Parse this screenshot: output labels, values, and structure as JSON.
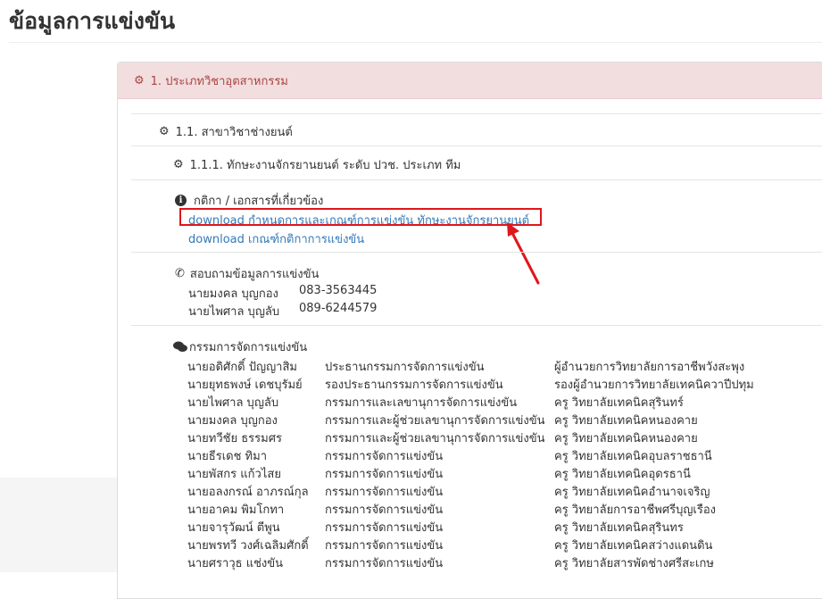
{
  "page": {
    "title": "ข้อมูลการแข่งขัน"
  },
  "category": {
    "heading": "1. ประเภทวิชาอุตสาหกรรม"
  },
  "branch": {
    "heading": "1.1. สาขาวิชาช่างยนต์"
  },
  "competition": {
    "heading": "1.1.1. ทักษะงานจักรยานยนต์ ระดับ ปวช. ประเภท ทีม"
  },
  "documents": {
    "title": "กติกา / เอกสารที่เกี่ยวข้อง",
    "links": [
      "download กำหนดการและเกณฑ์การแข่งขัน ทักษะงานจักรยานยนต์",
      "download เกณฑ์กติกาการแข่งขัน"
    ]
  },
  "inquiry": {
    "title": "สอบถามข้อมูลการแข่งขัน",
    "contacts": [
      {
        "name": "นายมงคล บุญกอง",
        "phone": "083-3563445"
      },
      {
        "name": "นายไพศาล บุญลับ",
        "phone": "089-6244579"
      }
    ]
  },
  "committee": {
    "title": "กรรมการจัดการแข่งขัน",
    "members": [
      {
        "name": "นายอดิศักดิ์ ปัญญาสิม",
        "role": "ประธานกรรมการจัดการแข่งขัน",
        "org": "ผู้อำนวยการวิทยาลัยการอาชีพวังสะพุง"
      },
      {
        "name": "นายยุทธพงษ์ เดชบุรัมย์",
        "role": "รองประธานกรรมการจัดการแข่งขัน",
        "org": "รองผู้อำนวยการวิทยาลัยเทคนิควาปีปทุม"
      },
      {
        "name": "นายไพศาล บุญลับ",
        "role": "กรรมการและเลขานุการจัดการแข่งขัน",
        "org": "ครู วิทยาลัยเทคนิคสุรินทร์"
      },
      {
        "name": "นายมงคล บุญกอง",
        "role": "กรรมการและผู้ช่วยเลขานุการจัดการแข่งขัน",
        "org": "ครู วิทยาลัยเทคนิคหนองคาย"
      },
      {
        "name": "นายทวีชัย ธรรมศร",
        "role": "กรรมการและผู้ช่วยเลขานุการจัดการแข่งขัน",
        "org": "ครู วิทยาลัยเทคนิคหนองคาย"
      },
      {
        "name": "นายธีรเดช ทิมา",
        "role": "กรรมการจัดการแข่งขัน",
        "org": "ครู วิทยาลัยเทคนิคอุบลราชธานี"
      },
      {
        "name": "นายพัสกร แก้วไสย",
        "role": "กรรมการจัดการแข่งขัน",
        "org": "ครู วิทยาลัยเทคนิคอุดรธานี"
      },
      {
        "name": "นายอลงกรณ์ อาภรณ์กุล",
        "role": "กรรมการจัดการแข่งขัน",
        "org": "ครู วิทยาลัยเทคนิคอำนาจเจริญ"
      },
      {
        "name": "นายอาคม พิมโกทา",
        "role": "กรรมการจัดการแข่งขัน",
        "org": "ครู วิทยาลัยการอาชีพศรีบุญเรือง"
      },
      {
        "name": "นายจารุวัฒน์ ตีพูน",
        "role": "กรรมการจัดการแข่งขัน",
        "org": "ครู วิทยาลัยเทคนิคสุรินทร"
      },
      {
        "name": "นายพรทวี วงศ์เฉลิมศักดิ์",
        "role": "กรรมการจัดการแข่งขัน",
        "org": "ครู วิทยาลัยเทคนิคสว่างแดนดิน"
      },
      {
        "name": "นายศราวุธ แช่งขัน",
        "role": "กรรมการจัดการแข่งขัน",
        "org": "ครู วิทยาลัยสารพัดช่างศรีสะเกษ"
      }
    ]
  },
  "colors": {
    "heading_bg": "#f2dede",
    "heading_text": "#a94442",
    "link": "#337ab7",
    "highlight": "#e0161b"
  },
  "icons": {
    "gear": "gear-icon",
    "info": "info-icon",
    "phone": "phone-icon",
    "comments": "comments-icon"
  }
}
